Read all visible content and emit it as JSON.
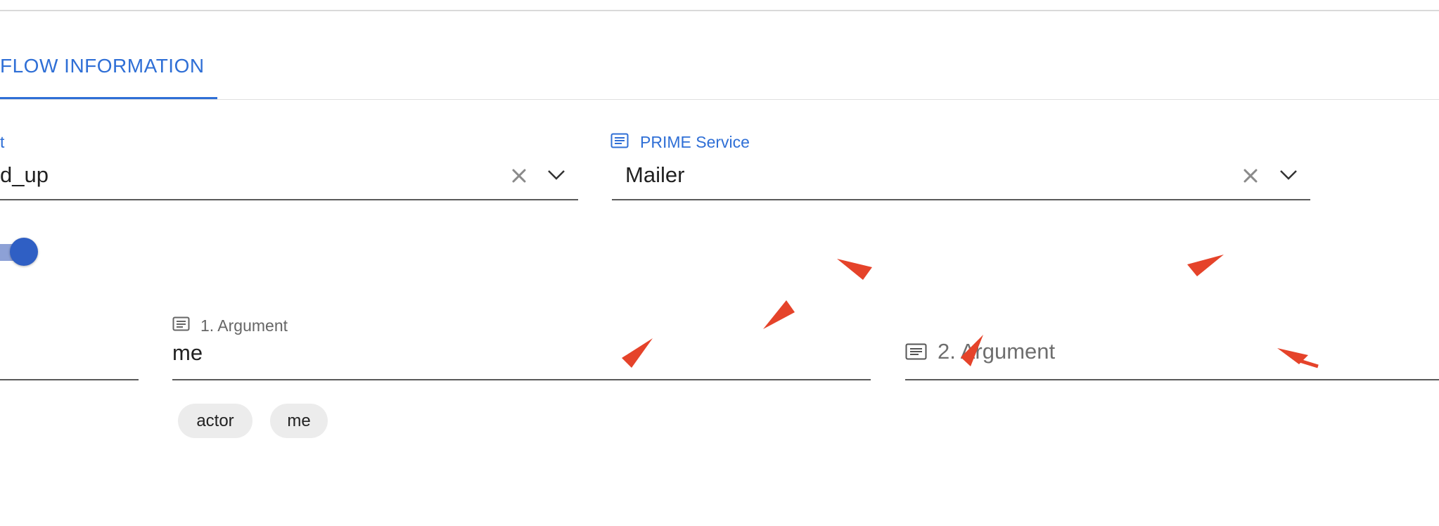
{
  "tabs": {
    "active_label": "FLOW  INFORMATION"
  },
  "event_field": {
    "label": "t",
    "value": "d_up"
  },
  "service_field": {
    "label": "PRIME Service",
    "value": "Mailer",
    "icon": "text-field-icon"
  },
  "argument_fields": [
    {
      "label": "1. Argument",
      "value": "me",
      "icon": "text-field-icon"
    },
    {
      "placeholder": "2. Argument",
      "icon": "text-field-icon"
    }
  ],
  "chips": [
    "actor",
    "me"
  ],
  "toggle": {
    "on": true
  },
  "colors": {
    "accent": "#2f6fd6",
    "toggle": "#2f5fc4",
    "annotation": "#e5432a"
  }
}
